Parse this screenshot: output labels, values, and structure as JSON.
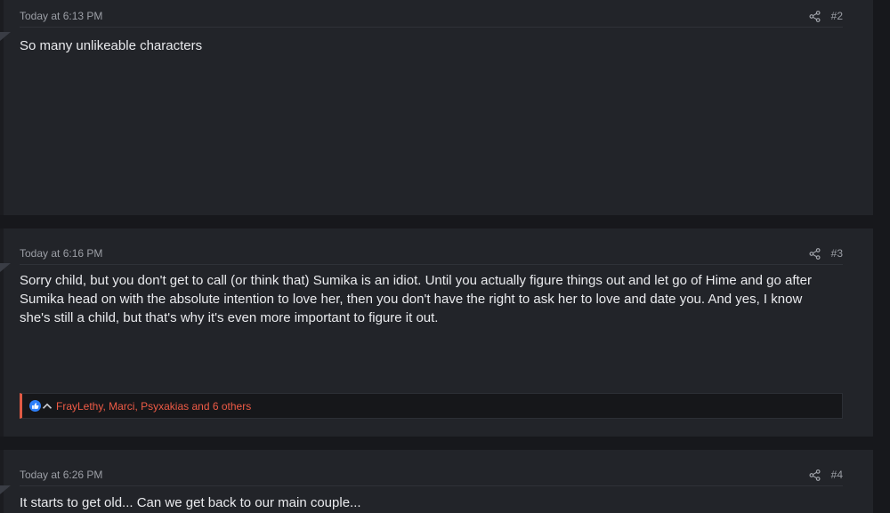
{
  "posts": [
    {
      "time": "Today at 6:13 PM",
      "number": "#2",
      "body": "So many unlikeable characters",
      "share_icon": "share-icon"
    },
    {
      "time": "Today at 6:16 PM",
      "number": "#3",
      "body": "Sorry child, but you don't get to call (or think that) Sumika is an idiot. Until you actually figure things out and let go of Hime and go after Sumika head on with the absolute intention to love her, then you don't have the right to ask her to love and date you. And yes, I know she's still a child, but that's why it's even more important to figure it out.",
      "share_icon": "share-icon",
      "reactions": {
        "text": "FrayLethy, Marci, Psyxakias and 6 others",
        "icons": [
          "like-icon",
          "chevron-up-icon"
        ]
      }
    },
    {
      "time": "Today at 6:26 PM",
      "number": "#4",
      "body": "It starts to get old... Can we get back to our main couple...",
      "share_icon": "share-icon"
    }
  ],
  "colors": {
    "page_bg": "#17181c",
    "post_bg": "#222429",
    "reaction_accent": "#e05a44",
    "reaction_text": "#ef5b46",
    "like_blue": "#2d7ff9"
  }
}
